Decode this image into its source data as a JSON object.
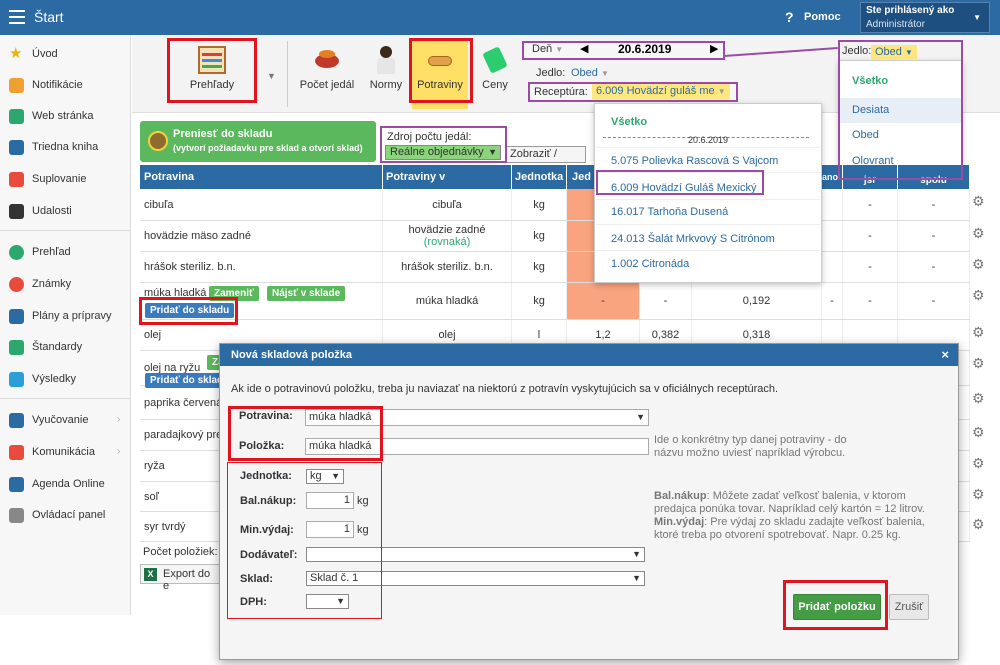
{
  "topbar": {
    "title": "Štart",
    "help": "Pomoc",
    "user_label": "Ste prihlásený ako",
    "user_name": "Administrátor",
    "bg": "#2b6aa3"
  },
  "sidebar": {
    "items": [
      {
        "label": "Úvod",
        "icon": "star-icon",
        "color": "#f0b400"
      },
      {
        "label": "Notifikácie",
        "icon": "envelope-icon",
        "color": "#f0a030"
      },
      {
        "label": "Web stránka",
        "icon": "home-icon",
        "color": "#2ca86f"
      },
      {
        "label": "Triedna kniha",
        "icon": "book-icon",
        "color": "#2b6aa3"
      },
      {
        "label": "Suplovanie",
        "icon": "person-icon",
        "color": "#e84b3c"
      },
      {
        "label": "Udalosti",
        "icon": "calendar-icon",
        "color": "#333333"
      },
      {
        "label": "Prehľad",
        "icon": "check-icon",
        "color": "#2ca86f"
      },
      {
        "label": "Známky",
        "icon": "grade-icon",
        "color": "#e84b3c"
      },
      {
        "label": "Plány a prípravy",
        "icon": "briefcase-icon",
        "color": "#2b6aa3"
      },
      {
        "label": "Štandardy",
        "icon": "shield-icon",
        "color": "#2ca86f"
      },
      {
        "label": "Výsledky",
        "icon": "chart-icon",
        "color": "#2b9fd6"
      },
      {
        "label": "Vyučovanie",
        "icon": "book-open-icon",
        "color": "#2b6aa3"
      },
      {
        "label": "Komunikácia",
        "icon": "chat-icon",
        "color": "#e84b3c"
      },
      {
        "label": "Agenda Online",
        "icon": "pen-icon",
        "color": "#2b6aa3"
      },
      {
        "label": "Ovládací panel",
        "icon": "gear-icon",
        "color": "#888888"
      }
    ]
  },
  "toolbar": {
    "prehlady": "Prehľady",
    "pocet": "Počet jedál",
    "normy": "Normy",
    "potraviny": "Potraviny",
    "ceny": "Ceny"
  },
  "filters": {
    "day_label": "Deň",
    "date": "20.6.2019",
    "jedlo_label": "Jedlo:",
    "jedlo_value": "Obed",
    "receptura_label": "Receptúra:",
    "receptura_value": "6.009 Hovädzí guláš me"
  },
  "jedlo_dropdown": [
    "Všetko",
    "Desiata",
    "Obed",
    "Olovrant"
  ],
  "recept_dropdown": {
    "all": "Všetko",
    "date": "20.6.2019",
    "items": [
      "5.075 Polievka Rascová S Vajcom",
      "6.009 Hovädzí Guláš Mexický",
      "16.017 Tarhoňa Dusená",
      "24.013 Šalát Mrkvový S Citrónom",
      "1.002 Citronáda"
    ]
  },
  "transfer": {
    "title": "Preniesť do skladu",
    "subtitle": "(vytvorí požiadavku pre sklad a otvorí sklad)"
  },
  "zdroj": {
    "label": "Zdroj počtu jedál:",
    "value": "Reálne objednávky"
  },
  "zobrazit": "Zobraziť / Upraviť",
  "table": {
    "headers": [
      "Potravina",
      "Potraviny v receptúrach",
      "Jednotka",
      "Jed",
      "ano",
      "jsr",
      "spolu"
    ],
    "rows": [
      {
        "name": "cibuľa",
        "recipe": "cibuľa",
        "recipe_note": "",
        "unit": "kg",
        "c1": "",
        "c2": "",
        "c3": "",
        "c4": "",
        "c5": "-",
        "c6": "-"
      },
      {
        "name": "hovädzie mäso zadné",
        "recipe": "hovädzie zadné",
        "recipe_note": "(rovnaká)",
        "unit": "kg",
        "c1": "",
        "c2": "",
        "c3": "",
        "c4": "",
        "c5": "-",
        "c6": "-"
      },
      {
        "name": "hrášok steriliz. b.n.",
        "recipe": "hrášok steriliz. b.n.",
        "recipe_note": "",
        "unit": "kg",
        "c1": "",
        "c2": "",
        "c3": "",
        "c4": "",
        "c5": "-",
        "c6": "-"
      },
      {
        "name": "múka hladká",
        "recipe": "múka hladká",
        "recipe_note": "",
        "unit": "kg",
        "c1": "-",
        "c2": "-",
        "c3": "0,192",
        "c4": "-",
        "c5": "-",
        "c6": "-"
      },
      {
        "name": "olej",
        "recipe": "olej",
        "recipe_note": "",
        "unit": "l",
        "c1": "1,2",
        "c2": "0,382",
        "c3": "0,318",
        "c4": "",
        "c5": "",
        "c6": ""
      },
      {
        "name": "olej na ryžu",
        "recipe": "",
        "recipe_note": "",
        "unit": "",
        "c1": "",
        "c2": "",
        "c3": "",
        "c4": "",
        "c5": "",
        "c6": ""
      },
      {
        "name": "paprika červená",
        "recipe": "",
        "recipe_note": "",
        "unit": "",
        "c1": "",
        "c2": "",
        "c3": "",
        "c4": "",
        "c5": "",
        "c6": ""
      },
      {
        "name": "paradajkový pre",
        "recipe": "",
        "recipe_note": "",
        "unit": "",
        "c1": "",
        "c2": "",
        "c3": "",
        "c4": "",
        "c5": "",
        "c6": ""
      },
      {
        "name": "ryža",
        "recipe": "",
        "recipe_note": "",
        "unit": "",
        "c1": "",
        "c2": "",
        "c3": "",
        "c4": "",
        "c5": "",
        "c6": ""
      },
      {
        "name": "soľ",
        "recipe": "",
        "recipe_note": "",
        "unit": "",
        "c1": "",
        "c2": "",
        "c3": "",
        "c4": "",
        "c5": "",
        "c6": ""
      },
      {
        "name": "syr tvrdý",
        "recipe": "",
        "recipe_note": "",
        "unit": "",
        "c1": "",
        "c2": "",
        "c3": "",
        "c4": "",
        "c5": "",
        "c6": ""
      }
    ],
    "replace": "Zameniť",
    "find": "Nájsť v sklade",
    "add_to_stock": "Pridať do skladu",
    "add_to_stock_short": "Pridať do sklad"
  },
  "footer": {
    "count": "Počet položiek:",
    "export": "Export do e"
  },
  "modal": {
    "title": "Nová skladová položka",
    "close": "×",
    "intro": "Ak ide o potravinovú položku, treba ju naviazať na niektorú z potravín vyskytujúcich sa v oficiálnych receptúrach.",
    "potravina_label": "Potravina:",
    "potravina_value": "múka hladká",
    "polozka_label": "Položka:",
    "polozka_value": "múka hladká",
    "polozka_hint": "Ide o konkrétny typ danej potraviny - do názvu možno uviesť napríklad výrobcu.",
    "jednotka_label": "Jednotka:",
    "jednotka_value": "kg",
    "nakup_label": "Bal.nákup:",
    "nakup_value": "1",
    "nakup_unit": "kg",
    "vydaj_label": "Min.výdaj:",
    "vydaj_value": "1",
    "vydaj_unit": "kg",
    "hint_nakup_title": "Bal.nákup",
    "hint_nakup": ": Môžete zadať veľkosť balenia, v ktorom predajca ponúka tovar. Napríklad celý kartón = 12 litrov.",
    "hint_vydaj_title": "Min.výdaj",
    "hint_vydaj": ": Pre výdaj zo skladu zadajte veľkosť balenia, ktoré treba po otvorení spotrebovať. Napr. 0.25 kg.",
    "dodavatel_label": "Dodávateľ:",
    "dodavatel_value": "",
    "sklad_label": "Sklad:",
    "sklad_value": "Sklad č. 1",
    "dph_label": "DPH:",
    "dph_value": "",
    "add_button": "Pridať položku",
    "cancel_button": "Zrušiť"
  }
}
